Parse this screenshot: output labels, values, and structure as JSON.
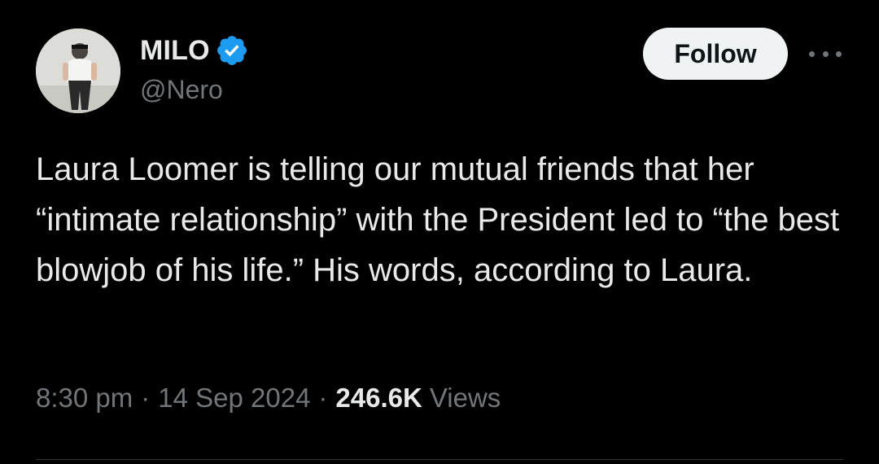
{
  "author": {
    "display_name": "MILO",
    "handle": "@Nero",
    "verified": true
  },
  "actions": {
    "follow_label": "Follow",
    "more_icon": "more-horizontal-icon"
  },
  "tweet": {
    "text": "Laura Loomer is telling our mutual friends that her “intimate relationship” with the President led to “the best blowjob of his life.” His words, according to Laura."
  },
  "meta": {
    "time": "8:30 pm",
    "separator": "·",
    "date": "14 Sep 2024",
    "views_count": "246.6K",
    "views_label": "Views"
  },
  "colors": {
    "background": "#000000",
    "primary_text": "#e7e9ea",
    "secondary_text": "#71767b",
    "verified_badge": "#1d9bf0",
    "follow_button_bg": "#eff3f4",
    "follow_button_text": "#0f1419"
  }
}
